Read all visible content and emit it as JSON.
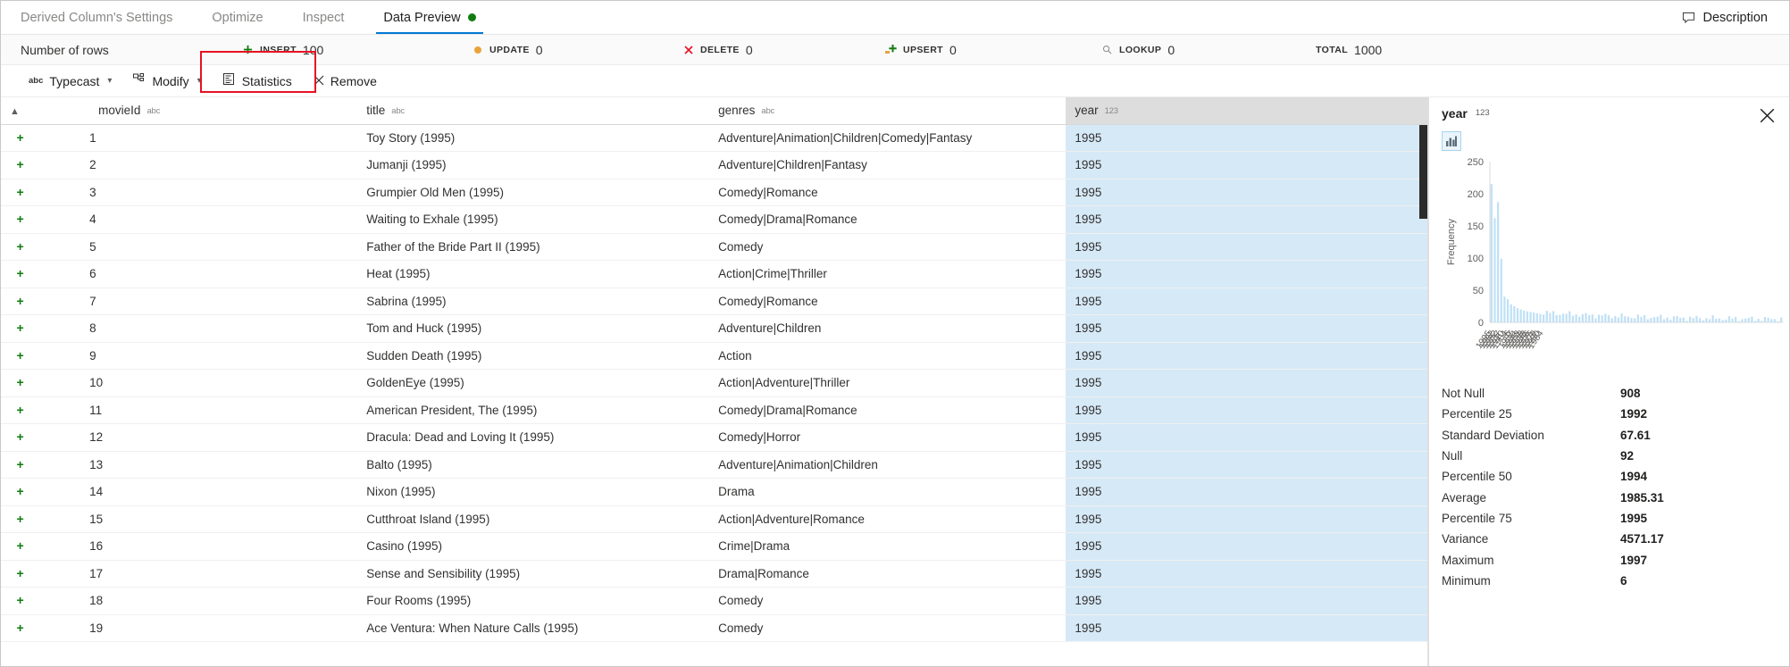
{
  "tabs": [
    {
      "label": "Derived Column's Settings",
      "active": false,
      "dot": false
    },
    {
      "label": "Optimize",
      "active": false,
      "dot": false
    },
    {
      "label": "Inspect",
      "active": false,
      "dot": false
    },
    {
      "label": "Data Preview",
      "active": true,
      "dot": true
    }
  ],
  "description_button": "Description",
  "summary": {
    "rows_label": "Number of rows",
    "stats": [
      {
        "icon": "plus-icon",
        "label": "INSERT",
        "value": "100",
        "color": "#107c10"
      },
      {
        "icon": "circle-icon",
        "label": "UPDATE",
        "value": "0",
        "color": "#e8a33d"
      },
      {
        "icon": "x-icon",
        "label": "DELETE",
        "value": "0",
        "color": "#e81123"
      },
      {
        "icon": "upsert-icon",
        "label": "UPSERT",
        "value": "0",
        "color": "#107c10"
      },
      {
        "icon": "search-icon",
        "label": "LOOKUP",
        "value": "0",
        "color": "#8a8886"
      },
      {
        "icon": "none",
        "label": "TOTAL",
        "value": "1000",
        "color": "#8a8886"
      }
    ]
  },
  "toolbar": {
    "typecast": "Typecast",
    "modify": "Modify",
    "statistics": "Statistics",
    "remove": "Remove",
    "highlight_color": "#e81123"
  },
  "grid": {
    "columns": [
      {
        "name": "movieId",
        "type": "abc",
        "selected": false
      },
      {
        "name": "title",
        "type": "abc",
        "selected": false
      },
      {
        "name": "genres",
        "type": "abc",
        "selected": false
      },
      {
        "name": "year",
        "type": "123",
        "selected": true
      }
    ],
    "rows": [
      {
        "movieId": "1",
        "title": "Toy Story (1995)",
        "genres": "Adventure|Animation|Children|Comedy|Fantasy",
        "year": "1995"
      },
      {
        "movieId": "2",
        "title": "Jumanji (1995)",
        "genres": "Adventure|Children|Fantasy",
        "year": "1995"
      },
      {
        "movieId": "3",
        "title": "Grumpier Old Men (1995)",
        "genres": "Comedy|Romance",
        "year": "1995"
      },
      {
        "movieId": "4",
        "title": "Waiting to Exhale (1995)",
        "genres": "Comedy|Drama|Romance",
        "year": "1995"
      },
      {
        "movieId": "5",
        "title": "Father of the Bride Part II (1995)",
        "genres": "Comedy",
        "year": "1995"
      },
      {
        "movieId": "6",
        "title": "Heat (1995)",
        "genres": "Action|Crime|Thriller",
        "year": "1995"
      },
      {
        "movieId": "7",
        "title": "Sabrina (1995)",
        "genres": "Comedy|Romance",
        "year": "1995"
      },
      {
        "movieId": "8",
        "title": "Tom and Huck (1995)",
        "genres": "Adventure|Children",
        "year": "1995"
      },
      {
        "movieId": "9",
        "title": "Sudden Death (1995)",
        "genres": "Action",
        "year": "1995"
      },
      {
        "movieId": "10",
        "title": "GoldenEye (1995)",
        "genres": "Action|Adventure|Thriller",
        "year": "1995"
      },
      {
        "movieId": "11",
        "title": "American President, The (1995)",
        "genres": "Comedy|Drama|Romance",
        "year": "1995"
      },
      {
        "movieId": "12",
        "title": "Dracula: Dead and Loving It (1995)",
        "genres": "Comedy|Horror",
        "year": "1995"
      },
      {
        "movieId": "13",
        "title": "Balto (1995)",
        "genres": "Adventure|Animation|Children",
        "year": "1995"
      },
      {
        "movieId": "14",
        "title": "Nixon (1995)",
        "genres": "Drama",
        "year": "1995"
      },
      {
        "movieId": "15",
        "title": "Cutthroat Island (1995)",
        "genres": "Action|Adventure|Romance",
        "year": "1995"
      },
      {
        "movieId": "16",
        "title": "Casino (1995)",
        "genres": "Crime|Drama",
        "year": "1995"
      },
      {
        "movieId": "17",
        "title": "Sense and Sensibility (1995)",
        "genres": "Drama|Romance",
        "year": "1995"
      },
      {
        "movieId": "18",
        "title": "Four Rooms (1995)",
        "genres": "Comedy",
        "year": "1995"
      },
      {
        "movieId": "19",
        "title": "Ace Ventura: When Nature Calls (1995)",
        "genres": "Comedy",
        "year": "1995"
      }
    ]
  },
  "panel": {
    "column_name": "year",
    "column_type": "123",
    "close_label": "close",
    "chart_toggle_icon": "bar-chart-icon",
    "stats": [
      {
        "key": "Not Null",
        "value": "908"
      },
      {
        "key": "Percentile 25",
        "value": "1992"
      },
      {
        "key": "Standard Deviation",
        "value": "67.61"
      },
      {
        "key": "Null",
        "value": "92"
      },
      {
        "key": "Percentile 50",
        "value": "1994"
      },
      {
        "key": "Average",
        "value": "1985.31"
      },
      {
        "key": "Percentile 75",
        "value": "1995"
      },
      {
        "key": "Variance",
        "value": "4571.17"
      },
      {
        "key": "Maximum",
        "value": "1997"
      },
      {
        "key": "Minimum",
        "value": "6"
      }
    ]
  },
  "chart_data": {
    "type": "bar",
    "title": "",
    "xlabel": "",
    "ylabel": "Frequency",
    "ylim": [
      0,
      250
    ],
    "yticks": [
      0,
      50,
      100,
      150,
      200,
      250
    ],
    "grid": false,
    "legend": null,
    "bar_color": "#bfe0f5",
    "categories": [
      "1995",
      "1992",
      "1982",
      "1937",
      "1970",
      "1964",
      "6",
      "1957",
      "1934",
      "1963",
      "1939",
      "1938",
      "1956",
      "1975",
      "1979",
      "1980",
      "1984"
    ],
    "values": [
      215,
      162,
      187,
      99,
      40,
      36,
      28,
      25,
      22,
      20,
      18,
      17,
      16,
      15,
      14,
      13,
      12
    ],
    "tick_labels": [
      "1995",
      "1992",
      "1982",
      "1937",
      "1970",
      "1964",
      "6",
      "1957",
      "1934",
      "1963",
      "1939",
      "1938",
      "1956",
      "1975",
      "1979",
      "1980",
      "1984"
    ],
    "notes": "Long-tailed histogram of year values; first bars ~215, ~162, ~187, ~99 then a long tail of small bars under ~30."
  }
}
